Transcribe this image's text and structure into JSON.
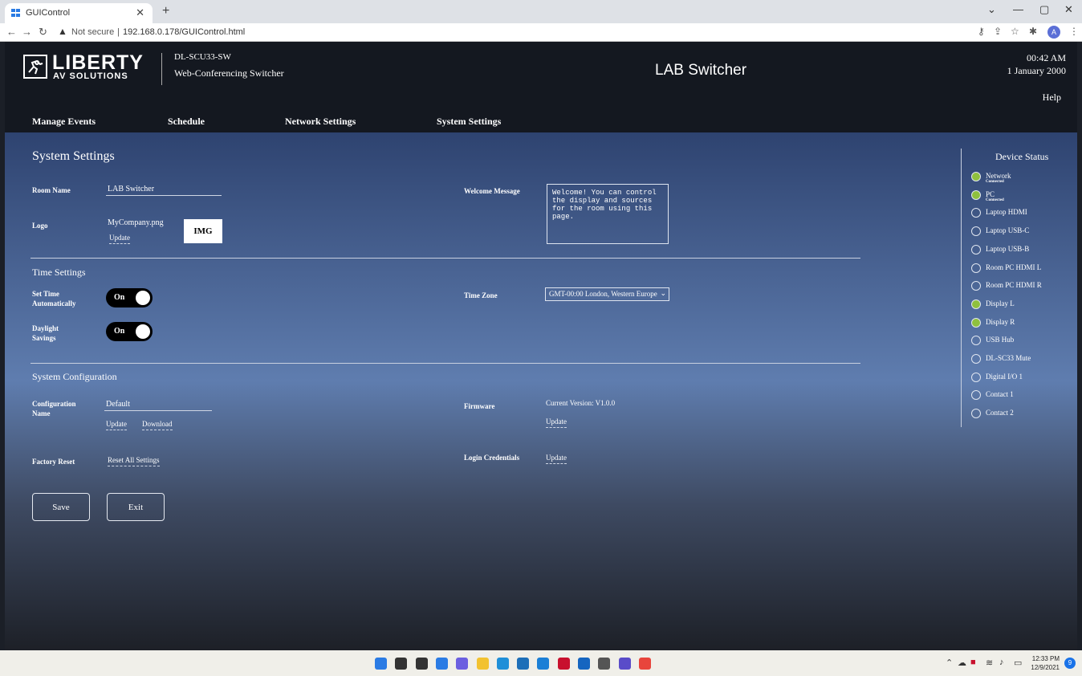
{
  "browser": {
    "tab_title": "GUIControl",
    "close_glyph": "✕",
    "new_tab_glyph": "+",
    "not_secure": "Not secure",
    "url": "192.168.0.178/GUIControl.html",
    "window_controls": [
      "⌄",
      "—",
      "▢",
      "✕"
    ],
    "avatar_letter": "A"
  },
  "header": {
    "brand_line1": "LIBERTY",
    "brand_line2": "AV SOLUTIONS",
    "model": "DL-SCU33-SW",
    "subtitle": "Web-Conferencing Switcher",
    "room_title": "LAB Switcher",
    "time": "00:42 AM",
    "date": "1 January 2000",
    "help": "Help",
    "menu": [
      "Manage Events",
      "Schedule",
      "Network Settings",
      "System Settings"
    ]
  },
  "system_settings": {
    "title": "System Settings",
    "room_name_label": "Room Name",
    "room_name_value": "LAB Switcher",
    "logo_label": "Logo",
    "logo_file": "MyCompany.png",
    "logo_update": "Update",
    "img_placeholder": "IMG",
    "welcome_label": "Welcome Message",
    "welcome_text": "Welcome! You can control the display and sources for the room using this page."
  },
  "time_settings": {
    "title": "Time Settings",
    "set_time_label_1": "Set Time",
    "set_time_label_2": "Automatically",
    "set_time_toggle": "On",
    "daylight_label_1": "Daylight",
    "daylight_label_2": "Savings",
    "daylight_toggle": "On",
    "timezone_label": "Time Zone",
    "timezone_value": "GMT-00:00 London, Western Europe"
  },
  "system_config": {
    "title": "System Configuration",
    "config_label_1": "Configuration",
    "config_label_2": "Name",
    "config_value": "Default",
    "update": "Update",
    "download": "Download",
    "factory_reset_label": "Factory Reset",
    "reset_all": "Reset All Settings",
    "firmware_label": "Firmware",
    "firmware_version": "Current Version: V1.0.0",
    "firmware_update": "Update",
    "login_label": "Login Credentials",
    "login_update": "Update"
  },
  "actions": {
    "save": "Save",
    "exit": "Exit"
  },
  "device_status": {
    "title": "Device Status",
    "items": [
      {
        "name": "Network",
        "status": "Connected",
        "on": true
      },
      {
        "name": "PC",
        "status": "Connected",
        "on": true
      },
      {
        "name": "Laptop HDMI",
        "status": "",
        "on": false
      },
      {
        "name": "Laptop USB-C",
        "status": "",
        "on": false
      },
      {
        "name": "Laptop USB-B",
        "status": "",
        "on": false
      },
      {
        "name": "Room PC HDMI L",
        "status": "",
        "on": false
      },
      {
        "name": "Room PC HDMI R",
        "status": "",
        "on": false
      },
      {
        "name": "Display L",
        "status": "",
        "on": true
      },
      {
        "name": "Display R",
        "status": "",
        "on": true
      },
      {
        "name": "USB Hub",
        "status": "",
        "on": false
      },
      {
        "name": "DL-SC33 Mute",
        "status": "",
        "on": false
      },
      {
        "name": "Digital I/O 1",
        "status": "",
        "on": false
      },
      {
        "name": "Contact 1",
        "status": "",
        "on": false
      },
      {
        "name": "Contact 2",
        "status": "",
        "on": false
      }
    ],
    "on_color": "#8fc13e"
  },
  "taskbar": {
    "icons": [
      {
        "name": "windows-start-icon",
        "color": "#2a7be4"
      },
      {
        "name": "search-icon",
        "color": "#333333"
      },
      {
        "name": "task-view-icon",
        "color": "#333333"
      },
      {
        "name": "widgets-icon",
        "color": "#2a7be4"
      },
      {
        "name": "chat-icon",
        "color": "#6b5fe0"
      },
      {
        "name": "file-explorer-icon",
        "color": "#f2c230"
      },
      {
        "name": "edge-icon",
        "color": "#1f8fd8"
      },
      {
        "name": "store-icon",
        "color": "#1d6fb8"
      },
      {
        "name": "outlook-icon",
        "color": "#1b7fd6"
      },
      {
        "name": "mcafee-icon",
        "color": "#c8102e"
      },
      {
        "name": "mail-icon",
        "color": "#1565c0"
      },
      {
        "name": "calculator-icon",
        "color": "#555555"
      },
      {
        "name": "snipping-tool-icon",
        "color": "#5a4cc9"
      },
      {
        "name": "chrome-icon",
        "color": "#e8453c"
      }
    ],
    "clock_time": "12:33 PM",
    "clock_date": "12/9/2021",
    "notification_count": "9"
  }
}
